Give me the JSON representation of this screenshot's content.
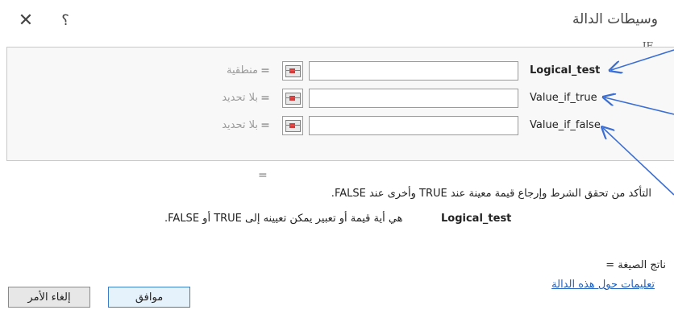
{
  "dialog": {
    "title": "وسيطات الدالة",
    "close_icon": "close-icon",
    "help_icon": "help-icon",
    "close_glyph": "✕",
    "help_glyph": "؟"
  },
  "function_name": "IF",
  "arguments": [
    {
      "name": "Logical_test",
      "hint": "منطقية",
      "value": "",
      "equals": "="
    },
    {
      "name": "Value_if_true",
      "hint": "بلا تحديد",
      "value": "",
      "equals": "="
    },
    {
      "name": "Value_if_false",
      "hint": "بلا تحديد",
      "value": "",
      "equals": "="
    }
  ],
  "result_equals": "=",
  "description": "التأكد من تحقق الشرط وإرجاع قيمة معينة عند TRUE وأخرى عند FALSE.",
  "argument_help": {
    "name": "Logical_test",
    "text": "هي أية قيمة أو تعبير يمكن تعيينه إلى TRUE أو FALSE."
  },
  "formula_result": "ناتج الصيغة =",
  "help_link": "تعليمات حول هذه الدالة",
  "buttons": {
    "ok": "موافق",
    "cancel": "إلغاء الأمر"
  },
  "colors": {
    "annotation_arrow": "#3b6fd4",
    "link": "#1f5fbf"
  }
}
